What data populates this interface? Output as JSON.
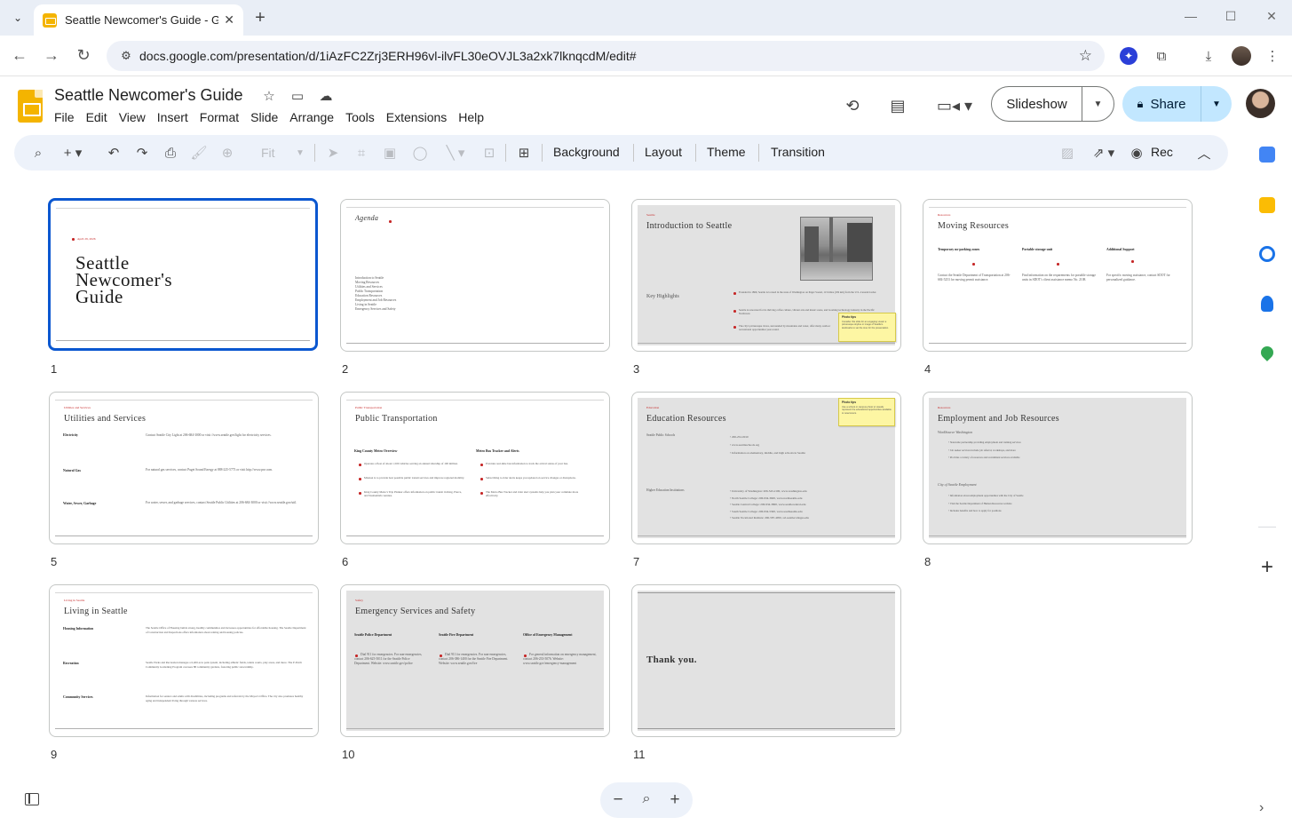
{
  "browser": {
    "tab_title": "Seattle Newcomer's Guide - Go",
    "url": "docs.google.com/presentation/d/1iAzFC2Zrj3ERH96vl-ilvFL30eOVJL3a2xk7lknqcdM/edit#"
  },
  "doc": {
    "title": "Seattle Newcomer's Guide"
  },
  "menu": [
    "File",
    "Edit",
    "View",
    "Insert",
    "Format",
    "Slide",
    "Arrange",
    "Tools",
    "Extensions",
    "Help"
  ],
  "header": {
    "slideshow_label": "Slideshow",
    "share_label": "Share"
  },
  "toolbar": {
    "zoom_value": "Fit",
    "background_label": "Background",
    "layout_label": "Layout",
    "theme_label": "Theme",
    "transition_label": "Transition",
    "rec_label": "Rec"
  },
  "slides": [
    {
      "number": "1",
      "kicker": "April 29, 2026",
      "title": "Seattle Newcomer's Guide"
    },
    {
      "number": "2",
      "title": "Agenda",
      "items": [
        "Introduction to Seattle",
        "Moving Resources",
        "Utilities and Services",
        "Public Transportation",
        "Education Resources",
        "Employment and Job Resources",
        "Living in Seattle",
        "Emergency Services and Safety"
      ]
    },
    {
      "number": "3",
      "kicker": "Seattle",
      "title": "Introduction to Seattle",
      "subtitle": "Key Highlights",
      "bullets": [
        "Founded in 1869, Seattle is located in the state of Washington on Puget Sound, 113 miles (182 km) from the U.S.-Canada border.",
        "Seattle is renowned for its thriving coffee culture, vibrant arts and music scene, and booming technology industry in the Pacific Northwest.",
        "The city's picturesque views, surrounded by mountains and water, offer many outdoor recreational opportunities year-round."
      ],
      "note_title": "Photo tips",
      "note_body": "Consider this slide for an engaging visual: a picturesque skyline or image of Seattle's landmarks to set the tone for the presentation."
    },
    {
      "number": "4",
      "kicker": "Resources",
      "title": "Moving Resources",
      "columns": [
        {
          "head": "Temporary no-parking zones",
          "body": "Contact the Seattle Department of Transportation at 206-684-5253 for moving permit assistance."
        },
        {
          "head": "Portable storage unit",
          "body": "Find information on the requirements for portable storage units in SDOT's client assistance memo No. 2108."
        },
        {
          "head": "Additional Support",
          "body": "For specific moving assistance, contact SDOT for personalized guidance."
        }
      ]
    },
    {
      "number": "5",
      "kicker": "Utilities and Services",
      "title": "Utilities and Services",
      "rows": [
        {
          "label": "Electricity",
          "text": "Contact Seattle City Light at 206-684-3000 or visit //www.seattle.gov/light for electricity services."
        },
        {
          "label": "Natural Gas",
          "text": "For natural gas services, contact Puget Sound Energy at 888-225-5773 or visit http://www.pse.com."
        },
        {
          "label": "Water, Sewer, Garbage",
          "text": "For water, sewer, and garbage services, contact Seattle Public Utilities at 206-684-3000 or visit //www.seattle.gov/util."
        }
      ]
    },
    {
      "number": "6",
      "kicker": "Public Transportation",
      "title": "Public Transportation",
      "columns": [
        {
          "head": "King County Metro Overview",
          "bullets": [
            "Operates a fleet of about 1,500 vehicles serving an annual ridership of 100 million.",
            "Mission is to provide best possible public transit services and improve regional mobility.",
            "King County Metro's Trip Planner offers information on public transit in King, Pierce, and Snohomish counties."
          ]
        },
        {
          "head": "Metro Bus Tracker and Alerts",
          "bullets": [
            "Provides real-time bus information to track the arrival status of your bus.",
            "Subscribing to rider alerts keeps you updated on service changes or disruptions.",
            "The Metro Bus Tracker and rider alert systems help you plan your commute more effectively."
          ]
        }
      ]
    },
    {
      "number": "7",
      "kicker": "Education",
      "title": "Education Resources",
      "groups": [
        {
          "label": "Seattle Public Schools",
          "items": [
            "206-252-0010",
            "www.seattleschools.org",
            "Information on elementary, middle, and high schools in Seattle"
          ]
        },
        {
          "label": "Higher Education Institutions",
          "items": [
            "University of Washington: 206-543-2100, www.washington.edu",
            "North Seattle College: 206-934-3600, www.northseattle.edu",
            "Seattle Central College: 206-934-3800, www.seattlecentral.edu",
            "South Seattle College: 206-934-5300, www.southseattle.edu",
            "Seattle Vocational Institute: 206-587-4950, svi.seattlecolleges.edu"
          ]
        }
      ],
      "note_title": "Photo tips",
      "note_body": "Use a school or campus photo to visually represent the educational opportunities available to newcomers."
    },
    {
      "number": "8",
      "kicker": "Resources",
      "title": "Employment and Job Resources",
      "groups": [
        {
          "label": "WorkSource Washington",
          "items": [
            "Statewide partnership providing employment and training services",
            "Job seeker services include job referral, workshops, and more",
            "Provides a variety of resources and recruitment services available"
          ]
        },
        {
          "label": "City of Seattle Employment",
          "items": [
            "Information about employment opportunities with the City of Seattle",
            "Visit the Seattle Department of Human Resources website",
            "Includes benefits and how to apply for positions"
          ]
        }
      ]
    },
    {
      "number": "9",
      "kicker": "Living in Seattle",
      "title": "Living in Seattle",
      "rows": [
        {
          "label": "Housing Information",
          "text": "The Seattle Office of Housing builds strong, healthy communities and increases opportunities for affordable housing. The Seattle Department of Construction and Inspections offers information about renting and housing policies."
        },
        {
          "label": "Recreation",
          "text": "Seattle Parks and Recreation manages a 6,400-acre park system, including athletic fields, tennis courts, play areas, and more. The P-Patch Community Gardening Program oversees 88 community gardens, fostering public stewardship."
        },
        {
          "label": "Community Services",
          "text": "Information for seniors and adults with disabilities, including programs and referrals by the Mayor's Office. The city also promotes healthy aging and independent living through various services."
        }
      ]
    },
    {
      "number": "10",
      "kicker": "Safety",
      "title": "Emergency Services and Safety",
      "columns": [
        {
          "head": "Seattle Police Department",
          "body": "Dial 911 for emergencies. For non-emergencies, contact 206-625-5011 for the Seattle Police Department. Website: www.seattle.gov/police"
        },
        {
          "head": "Seattle Fire Department",
          "body": "Dial 911 for emergencies. For non-emergencies, contact 206-386-1400 for the Seattle Fire Department. Website: www.seattle.gov/fire"
        },
        {
          "head": "Office of Emergency Management",
          "body": "For general information on emergency management, contact 206-233-5076. Website: www.seattle.gov/emergency-management"
        }
      ]
    },
    {
      "number": "11",
      "title": "Thank you."
    }
  ]
}
